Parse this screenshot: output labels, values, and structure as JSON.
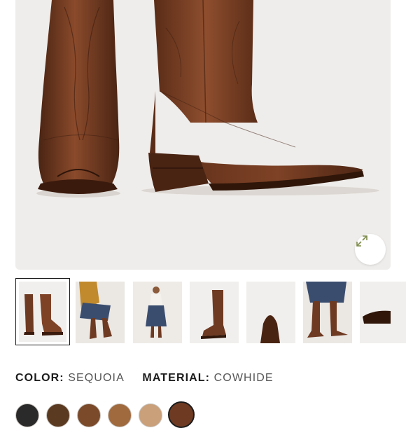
{
  "product": {
    "color_label": "COLOR:",
    "color_value": "SEQUOIA",
    "material_label": "MATERIAL:",
    "material_value": "COWHIDE"
  },
  "colors": {
    "leather": "#6e3a22",
    "leather_light": "#8a4a2b",
    "leather_dark": "#4a2413",
    "background": "#efedeb",
    "denim": "#3a4d6e",
    "mustard": "#c18a2c"
  },
  "icons": {
    "expand": "expand-arrows-icon"
  },
  "thumbnails": [
    {
      "name": "thumb-pair-front-side",
      "selected": true
    },
    {
      "name": "thumb-model-seated-mustard"
    },
    {
      "name": "thumb-model-standing-denim"
    },
    {
      "name": "thumb-single-side"
    },
    {
      "name": "thumb-toe-closeup"
    },
    {
      "name": "thumb-model-legs-denim"
    },
    {
      "name": "thumb-heel-detail"
    }
  ],
  "swatch_count": 6,
  "selected_swatch": 5
}
